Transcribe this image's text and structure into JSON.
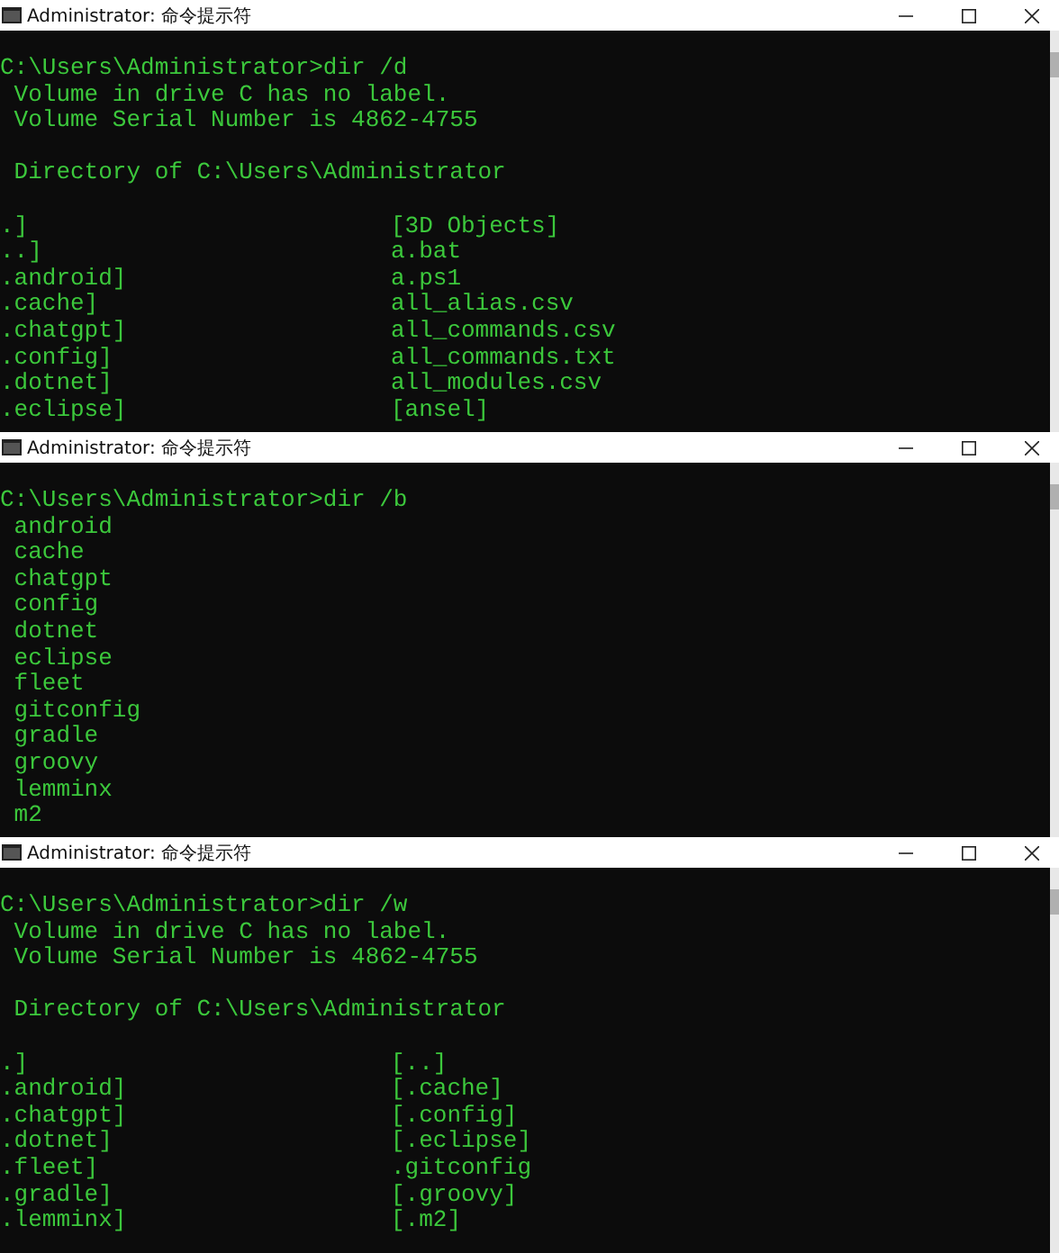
{
  "windows": [
    {
      "title": "Administrator: 命令提示符",
      "lines": [
        {
          "kind": "line",
          "text": "C:\\Users\\Administrator>dir /d"
        },
        {
          "kind": "line",
          "text": " Volume in drive C has no label."
        },
        {
          "kind": "line",
          "text": " Volume Serial Number is 4862-4755"
        },
        {
          "kind": "gap"
        },
        {
          "kind": "line",
          "text": " Directory of C:\\Users\\Administrator"
        },
        {
          "kind": "gap"
        },
        {
          "kind": "columns",
          "left": ".]",
          "right": "[3D Objects]"
        },
        {
          "kind": "columns",
          "left": "..]",
          "right": "a.bat"
        },
        {
          "kind": "columns",
          "left": ".android]",
          "right": "a.ps1"
        },
        {
          "kind": "columns",
          "left": ".cache]",
          "right": "all_alias.csv"
        },
        {
          "kind": "columns",
          "left": ".chatgpt]",
          "right": "all_commands.csv"
        },
        {
          "kind": "columns",
          "left": ".config]",
          "right": "all_commands.txt"
        },
        {
          "kind": "columns",
          "left": ".dotnet]",
          "right": "all_modules.csv"
        },
        {
          "kind": "columns",
          "left": ".eclipse]",
          "right": "[ansel]"
        }
      ]
    },
    {
      "title": "Administrator: 命令提示符",
      "lines": [
        {
          "kind": "line",
          "text": "C:\\Users\\Administrator>dir /b"
        },
        {
          "kind": "line",
          "text": " android"
        },
        {
          "kind": "line",
          "text": " cache"
        },
        {
          "kind": "line",
          "text": " chatgpt"
        },
        {
          "kind": "line",
          "text": " config"
        },
        {
          "kind": "line",
          "text": " dotnet"
        },
        {
          "kind": "line",
          "text": " eclipse"
        },
        {
          "kind": "line",
          "text": " fleet"
        },
        {
          "kind": "line",
          "text": " gitconfig"
        },
        {
          "kind": "line",
          "text": " gradle"
        },
        {
          "kind": "line",
          "text": " groovy"
        },
        {
          "kind": "line",
          "text": " lemminx"
        },
        {
          "kind": "line",
          "text": " m2"
        }
      ]
    },
    {
      "title": "Administrator: 命令提示符",
      "lines": [
        {
          "kind": "line",
          "text": "C:\\Users\\Administrator>dir /w"
        },
        {
          "kind": "line",
          "text": " Volume in drive C has no label."
        },
        {
          "kind": "line",
          "text": " Volume Serial Number is 4862-4755"
        },
        {
          "kind": "gap"
        },
        {
          "kind": "line",
          "text": " Directory of C:\\Users\\Administrator"
        },
        {
          "kind": "gap"
        },
        {
          "kind": "columns",
          "left": ".]",
          "right": "[..]"
        },
        {
          "kind": "columns",
          "left": ".android]",
          "right": "[.cache]"
        },
        {
          "kind": "columns",
          "left": ".chatgpt]",
          "right": "[.config]"
        },
        {
          "kind": "columns",
          "left": ".dotnet]",
          "right": "[.eclipse]"
        },
        {
          "kind": "columns",
          "left": ".fleet]",
          "right": ".gitconfig"
        },
        {
          "kind": "columns",
          "left": ".gradle]",
          "right": "[.groovy]"
        },
        {
          "kind": "columns",
          "left": ".lemminx]",
          "right": "[.m2]"
        }
      ]
    }
  ]
}
